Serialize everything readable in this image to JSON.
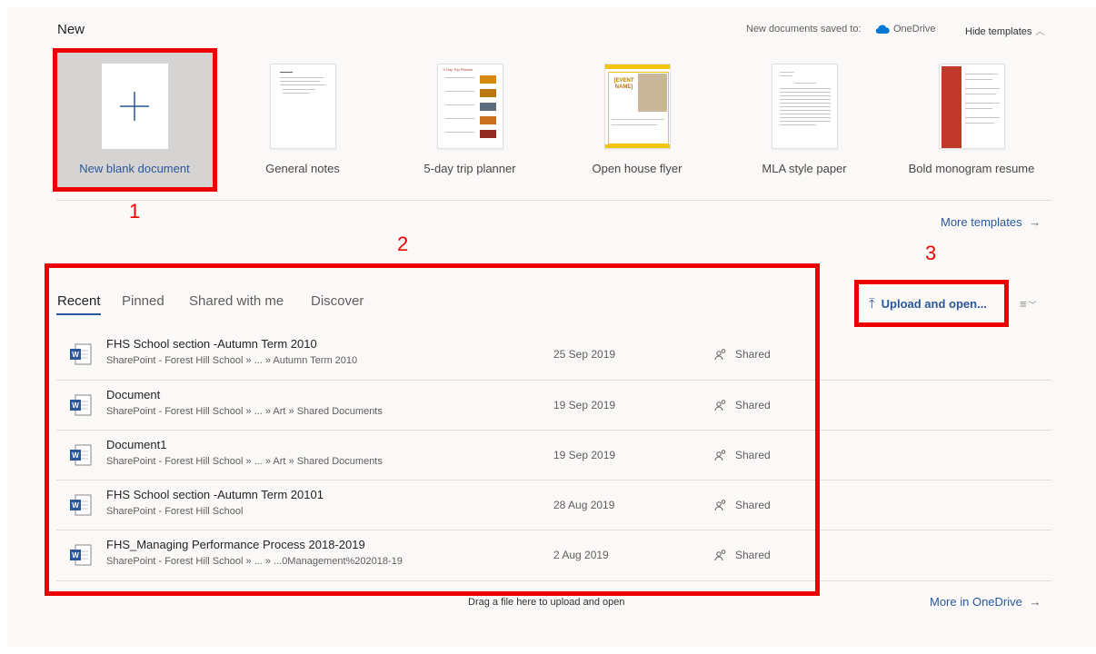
{
  "header": {
    "title": "New",
    "saved_to_label": "New documents saved to:",
    "saved_to_location": "OneDrive",
    "hide_templates": "Hide templates"
  },
  "templates": [
    {
      "label": "New blank document",
      "icon": "plus-icon"
    },
    {
      "label": "General notes"
    },
    {
      "label": "5-day trip planner",
      "thumb_title": "5 Day Trip Planner"
    },
    {
      "label": "Open house flyer",
      "thumb_title": "[EVENT NAME]"
    },
    {
      "label": "MLA style paper"
    },
    {
      "label": "Bold monogram resume"
    }
  ],
  "more_templates": "More templates",
  "callouts": [
    "1",
    "2",
    "3"
  ],
  "tabs": [
    {
      "label": "Recent",
      "active": true
    },
    {
      "label": "Pinned",
      "active": false
    },
    {
      "label": "Shared with me",
      "active": false
    },
    {
      "label": "Discover",
      "active": false
    }
  ],
  "upload_button": "Upload and open...",
  "files": [
    {
      "name": "FHS School section -Autumn Term 2010",
      "path": "SharePoint - Forest Hill School » ... » Autumn Term 2010",
      "date": "25 Sep 2019",
      "sharing": "Shared"
    },
    {
      "name": "Document",
      "path": "SharePoint - Forest Hill School » ... » Art » Shared Documents",
      "date": "19 Sep 2019",
      "sharing": "Shared"
    },
    {
      "name": "Document1",
      "path": "SharePoint - Forest Hill School » ... » Art » Shared Documents",
      "date": "19 Sep 2019",
      "sharing": "Shared"
    },
    {
      "name": "FHS School section -Autumn Term 20101",
      "path": "SharePoint - Forest Hill School",
      "date": "28 Aug 2019",
      "sharing": "Shared"
    },
    {
      "name": "FHS_Managing Performance Process 2018-2019",
      "path": "SharePoint - Forest Hill School » ... » ...0Management%202018-19",
      "date": "2 Aug 2019",
      "sharing": "Shared"
    }
  ],
  "drag_hint": "Drag a file here to upload and open",
  "more_in_onedrive": "More in OneDrive",
  "colors": {
    "accent": "#2b579a",
    "callout": "#ee0000",
    "background": "#faf9f8"
  }
}
